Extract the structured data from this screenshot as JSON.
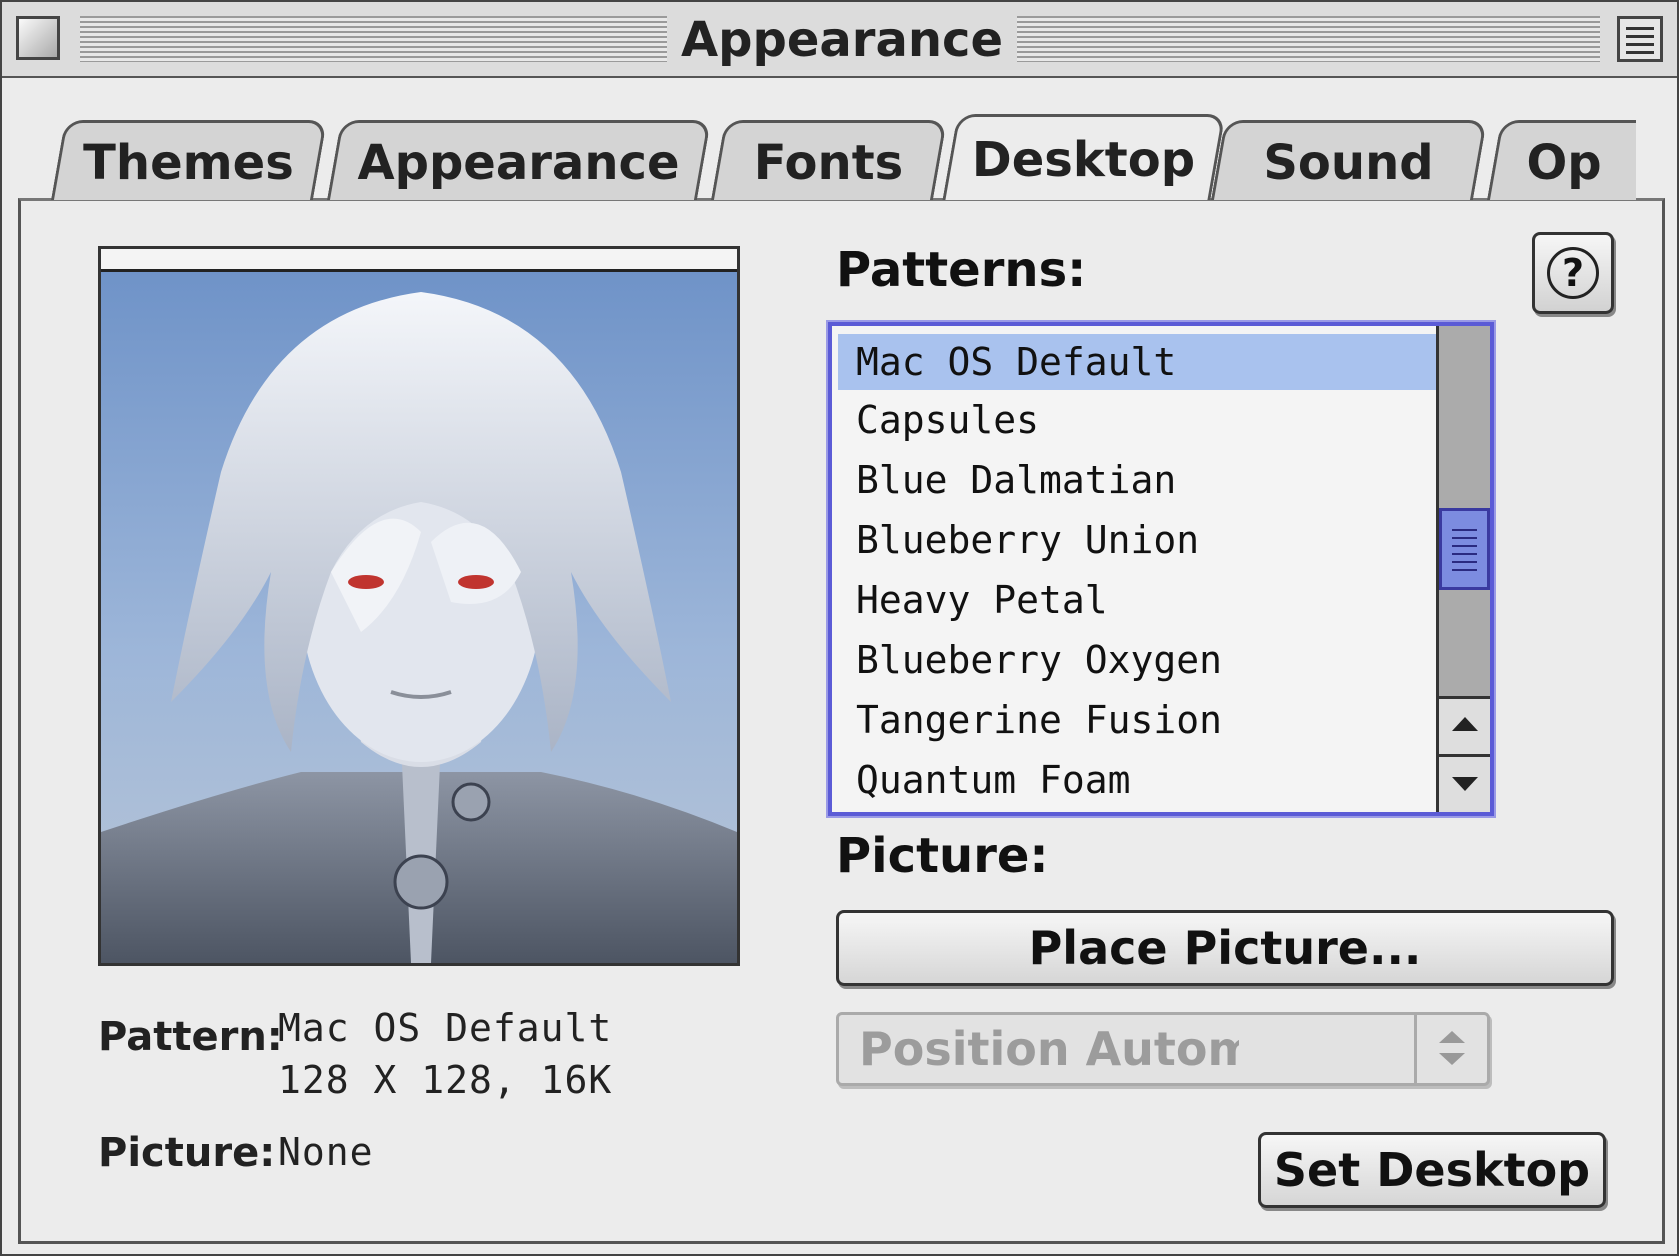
{
  "window": {
    "title": "Appearance"
  },
  "tabs": [
    {
      "label": "Themes"
    },
    {
      "label": "Appearance"
    },
    {
      "label": "Fonts"
    },
    {
      "label": "Desktop",
      "active": true
    },
    {
      "label": "Sound"
    },
    {
      "label": "Op"
    }
  ],
  "patterns": {
    "title": "Patterns:",
    "items": [
      "Mac OS Default",
      "Capsules",
      "Blue Dalmatian",
      "Blueberry Union",
      "Heavy Petal",
      "Blueberry Oxygen",
      "Tangerine Fusion",
      "Quantum Foam"
    ],
    "selected": "Mac OS Default"
  },
  "picture": {
    "title": "Picture:",
    "place_button": "Place Picture...",
    "position_popup": "Position Automatically"
  },
  "info": {
    "pattern_label": "Pattern:",
    "pattern_name": "Mac OS Default",
    "pattern_size": "128 X 128, 16K",
    "picture_label": "Picture:",
    "picture_value": "None"
  },
  "buttons": {
    "set_desktop": "Set Desktop",
    "help": "?"
  },
  "colors": {
    "selection": "#a9c2ee",
    "list_border": "#5b5bd6",
    "thumb": "#7c8ce0"
  }
}
